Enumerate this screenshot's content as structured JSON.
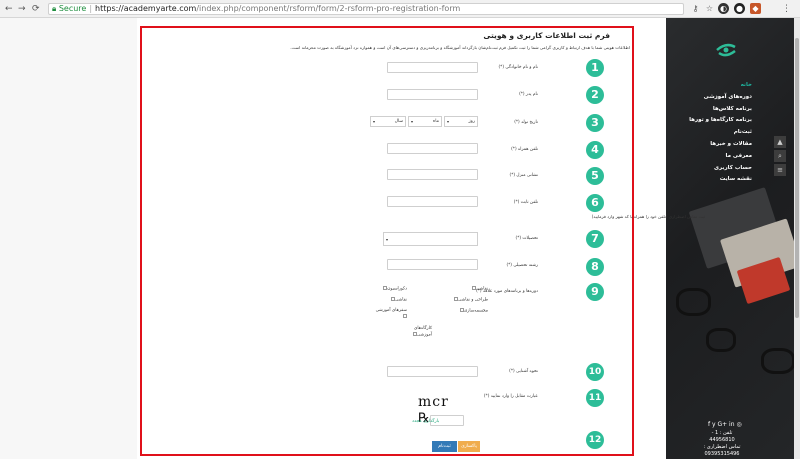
{
  "browser": {
    "secure_label": "Secure",
    "url_host": "https://academyarte.com",
    "url_path": "/index.php/component/rsform/form/2-rsform-pro-registration-form"
  },
  "form": {
    "title": "فرم ثبت اطلاعات کاربری و هویتی",
    "intro": "اطلاعات هویتی شما با هدف ارتباط و کاربری گرامی شما را ثبت تکمیل فرم ثبت‌نام‌شان بازگرداند آموزشگاه و برنامه‌ریزی و دسترسی‌های آن است و همواره نزد آموزشگاه به صورت محرمانه است.",
    "fields": [
      {
        "num": "1",
        "label": "نام و نام خانوادگی (*)"
      },
      {
        "num": "2",
        "label": "نام پدر (*)"
      },
      {
        "num": "3",
        "label": "تاریخ تولد (*)"
      },
      {
        "num": "4",
        "label": "تلفن همراه (*)"
      },
      {
        "num": "5",
        "label": "نشانی منزل (*)"
      },
      {
        "num": "6",
        "label": "تلفن ثابت (*)"
      },
      {
        "num": "7",
        "label": "تحصیلات (*)"
      },
      {
        "num": "8",
        "label": "رشته تحصیلی (*)"
      },
      {
        "num": "9",
        "label": "دوره‌ها و برنامه‌های مورد علاقه (*)"
      },
      {
        "num": "10",
        "label": "نحوه آشنایی (*)"
      },
      {
        "num": "11",
        "label": "عبارت مقابل را وارد نمایید (*)"
      },
      {
        "num": "12",
        "label": ""
      }
    ],
    "birth": {
      "day": "روز",
      "month": "ماه",
      "year": "سال"
    },
    "phone_note": "ثبت تماس اضطراری (تلفن خود را همراه با کد شهر وارد فرمایید)",
    "interests": [
      "نقاشی",
      "طراحی و نقاشی",
      "مجسمه‌سازی",
      "دکوراسیون",
      "نقاشی",
      "سفرهای آموزشی",
      "کارگاه‌های آموزشی"
    ],
    "captcha_text": "mcr",
    "refresh_label": "بارگذاری مجدد",
    "submit_label": "ثبت‌نام",
    "reset_label": "پاکسازی"
  },
  "sidebar": {
    "menu": [
      "خانه",
      "دوره‌های آموزشی",
      "برنامه کلاس‌ها",
      "برنامه کارگاه‌ها و تورها",
      "ثبت‌نام",
      "مقالات و خبرها",
      "معرفی ما",
      "حساب کاربری",
      "نقشه سایت"
    ],
    "social": "f  y  G+  in  ◎",
    "phone1": "تلفن : 1 - 44956810",
    "phone2": "تماس اضطراری : 09395315496"
  }
}
